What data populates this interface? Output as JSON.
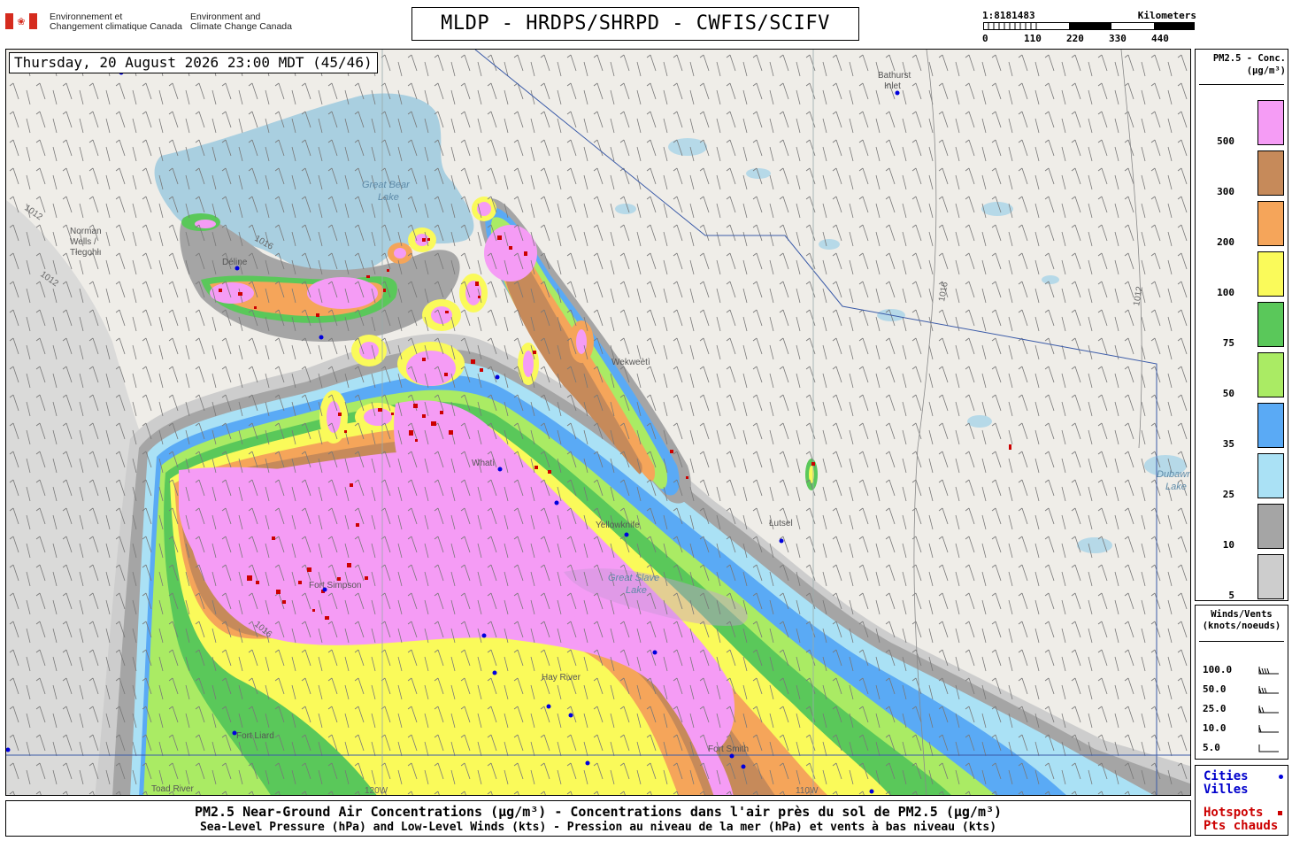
{
  "header": {
    "gov_fr": "Environnement et\nChangement climatique Canada",
    "gov_en": "Environment and\nClimate Change Canada",
    "title": "MLDP - HRDPS/SHRPD - CWFIS/SCIFV",
    "scale_ratio": "1:8181483",
    "scale_unit": "Kilometers",
    "scale_ticks": [
      "0",
      "110",
      "220",
      "330",
      "440"
    ]
  },
  "map": {
    "timestamp": "Thursday, 20 August 2026 23:00 MDT (45/46)",
    "places": [
      "Bathurst Inlet",
      "Norman Wells / Tłegohłı",
      "Déline",
      "Whatì",
      "Wekweètì",
      "Yellowknife",
      "Łutsel",
      "Hay River",
      "Fort Liard",
      "Fort Smith",
      "Toad River",
      "Fort Simpson"
    ],
    "lakes": [
      "Great Bear Lake",
      "Great Slave Lake",
      "Dubawnt Lake"
    ],
    "isobars": [
      "1012",
      "1016"
    ],
    "meridians": [
      "120W",
      "110W"
    ]
  },
  "legend": {
    "title": "PM2.5 - Conc.\n(µg/m³)",
    "bins": [
      {
        "label": "500",
        "color": "#f59cf5"
      },
      {
        "label": "300",
        "color": "#c68a5a"
      },
      {
        "label": "200",
        "color": "#f5a55a"
      },
      {
        "label": "100",
        "color": "#fafa5a"
      },
      {
        "label": "75",
        "color": "#5ac85a"
      },
      {
        "label": "50",
        "color": "#aaeb64"
      },
      {
        "label": "35",
        "color": "#5aaaf5"
      },
      {
        "label": "25",
        "color": "#aae1f5"
      },
      {
        "label": "10",
        "color": "#a5a5a5"
      },
      {
        "label": "5",
        "color": "#cdcdcd"
      }
    ]
  },
  "winds": {
    "title": "Winds/Vents\n(knots/noeuds)",
    "rows": [
      "100.0",
      "50.0",
      "25.0",
      "10.0",
      "5.0"
    ]
  },
  "key": {
    "cities": "Cities\nVilles",
    "hotspots": "Hotspots\nPts chauds",
    "city_color": "#0000dd",
    "hotspot_color": "#cc0000"
  },
  "footer": {
    "line1": "PM2.5 Near-Ground Air Concentrations (µg/m³) - Concentrations dans l'air près du sol de PM2.5 (µg/m³)",
    "line2": "Sea-Level Pressure (hPa) and Low-Level Winds (kts) - Pression au niveau de la mer (hPa) et vents à bas niveau (kts)"
  }
}
